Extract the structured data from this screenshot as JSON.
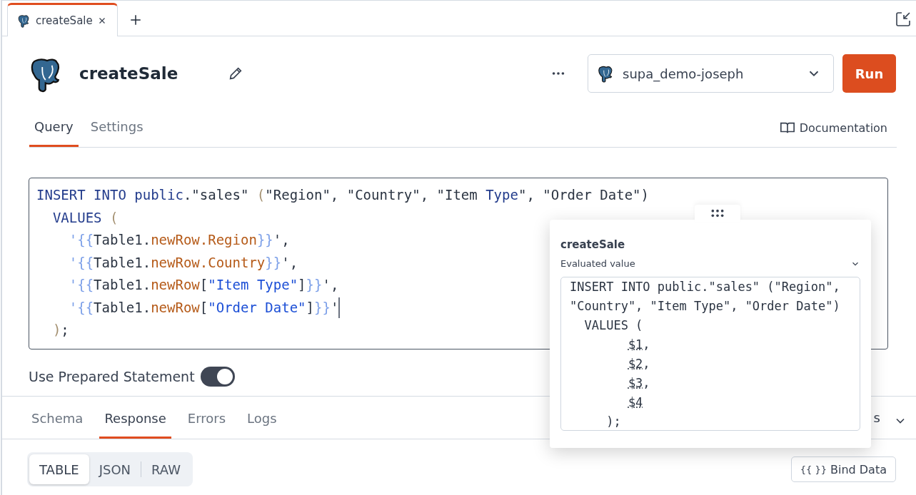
{
  "tabs": [
    {
      "label": "createSale",
      "selected": true
    }
  ],
  "header": {
    "title": "createSale",
    "datasource": "supa_demo-joseph",
    "run_button": "Run"
  },
  "query_tabs": [
    {
      "label": "Query",
      "selected": true
    },
    {
      "label": "Settings",
      "selected": false
    }
  ],
  "documentation_link": "Documentation",
  "code_lines": [
    {
      "cursor": false,
      "tokens": [
        {
          "t": "INSERT INTO public",
          "kind": "kw"
        },
        {
          "t": ".\"sales\" ",
          "kind": "plain"
        },
        {
          "t": "(",
          "kind": "paren"
        },
        {
          "t": "\"Region\", \"Country\", \"Item ",
          "kind": "plain"
        },
        {
          "t": "Type",
          "kind": "kw"
        },
        {
          "t": "\", \"Order Date\")",
          "kind": "plain"
        }
      ]
    },
    {
      "cursor": false,
      "tokens": [
        {
          "t": "  VALUES ",
          "kind": "kw"
        },
        {
          "t": "(",
          "kind": "paren"
        }
      ]
    },
    {
      "cursor": false,
      "tokens": [
        {
          "t": "    '{{",
          "kind": "brace"
        },
        {
          "t": "Table1.",
          "kind": "plain"
        },
        {
          "t": "newRow.Region",
          "kind": "prop"
        },
        {
          "t": "}}",
          "kind": "brace"
        },
        {
          "t": "',",
          "kind": "plain"
        }
      ]
    },
    {
      "cursor": false,
      "tokens": [
        {
          "t": "    '{{",
          "kind": "brace"
        },
        {
          "t": "Table1.",
          "kind": "plain"
        },
        {
          "t": "newRow.Country",
          "kind": "prop"
        },
        {
          "t": "}}",
          "kind": "brace"
        },
        {
          "t": "',",
          "kind": "plain"
        }
      ]
    },
    {
      "cursor": false,
      "tokens": [
        {
          "t": "    '{{",
          "kind": "brace"
        },
        {
          "t": "Table1.",
          "kind": "plain"
        },
        {
          "t": "newRow",
          "kind": "prop"
        },
        {
          "t": "[",
          "kind": "plain"
        },
        {
          "t": "\"Item Type\"",
          "kind": "str"
        },
        {
          "t": "]",
          "kind": "plain"
        },
        {
          "t": "}}",
          "kind": "brace"
        },
        {
          "t": "',",
          "kind": "plain"
        }
      ]
    },
    {
      "cursor": true,
      "tokens": [
        {
          "t": "    '{{",
          "kind": "brace"
        },
        {
          "t": "Table1.",
          "kind": "plain"
        },
        {
          "t": "newRow",
          "kind": "prop"
        },
        {
          "t": "[",
          "kind": "plain"
        },
        {
          "t": "\"Order Date\"",
          "kind": "str"
        },
        {
          "t": "]",
          "kind": "plain"
        },
        {
          "t": "}}",
          "kind": "brace"
        },
        {
          "t": "'",
          "kind": "plain"
        }
      ]
    },
    {
      "cursor": false,
      "tokens": [
        {
          "t": "  )",
          "kind": "paren"
        },
        {
          "t": ";",
          "kind": "plain"
        }
      ]
    }
  ],
  "prepared_statement": {
    "label": "Use Prepared Statement",
    "on": true
  },
  "response_tabs": [
    {
      "label": "Schema",
      "selected": false
    },
    {
      "label": "Response",
      "selected": true
    },
    {
      "label": "Errors",
      "selected": false
    },
    {
      "label": "Logs",
      "selected": false
    }
  ],
  "response_extra": "s",
  "view_toggle": [
    {
      "label": "TABLE",
      "selected": true
    },
    {
      "label": "JSON",
      "selected": false
    },
    {
      "label": "RAW",
      "selected": false
    }
  ],
  "bind_data_button": {
    "icon_text": "{{ }}",
    "label": "Bind Data"
  },
  "popover": {
    "title": "createSale",
    "section": "Evaluated value",
    "expanded": true,
    "lines": [
      {
        "kind": "statement",
        "tokens": [
          {
            "t": "INSERT INTO public.\"sales\" (\"Region\",",
            "kind": "plain"
          }
        ]
      },
      {
        "kind": "statement",
        "tokens": [
          {
            "t": "\"Country\", \"Item Type\", \"Order Date\")",
            "kind": "plain"
          }
        ]
      },
      {
        "kind": "statement",
        "tokens": [
          {
            "t": "  VALUES (",
            "kind": "plain"
          }
        ]
      },
      {
        "kind": "argument",
        "tokens": [
          {
            "t": "$1",
            "kind": "param"
          },
          {
            "t": ",",
            "kind": "plain"
          }
        ]
      },
      {
        "kind": "argument",
        "tokens": [
          {
            "t": "$2",
            "kind": "param"
          },
          {
            "t": ",",
            "kind": "plain"
          }
        ]
      },
      {
        "kind": "argument",
        "tokens": [
          {
            "t": "$3",
            "kind": "param"
          },
          {
            "t": ",",
            "kind": "plain"
          }
        ]
      },
      {
        "kind": "argument",
        "tokens": [
          {
            "t": "$4",
            "kind": "param"
          }
        ]
      },
      {
        "kind": "statement",
        "tokens": [
          {
            "t": "     );",
            "kind": "plain"
          }
        ]
      }
    ]
  }
}
